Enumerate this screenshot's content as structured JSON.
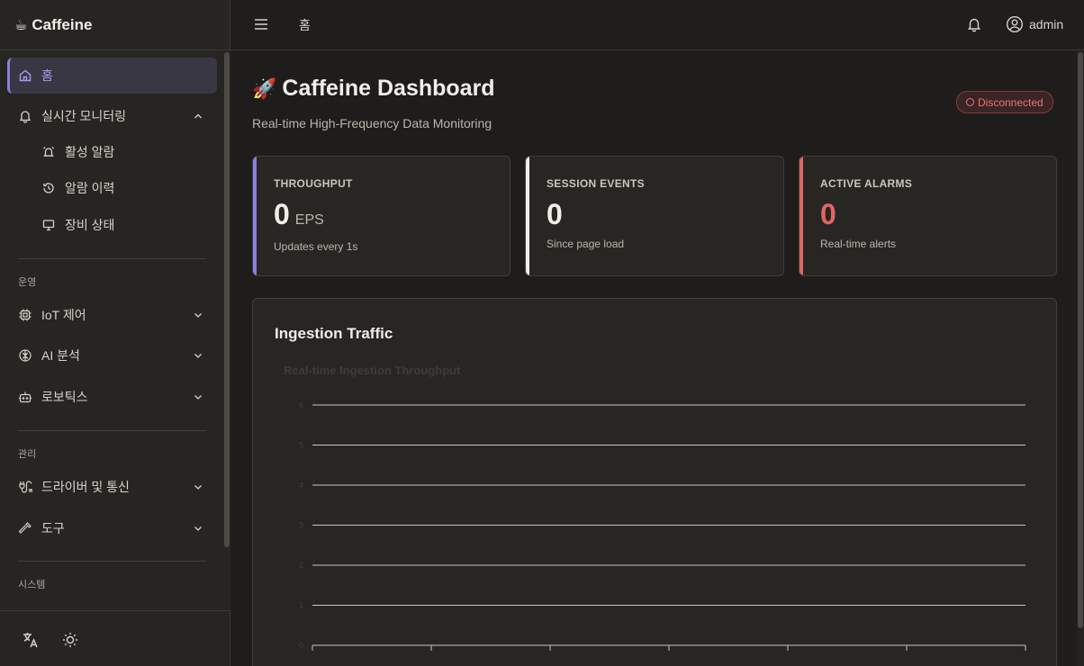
{
  "sidebar": {
    "brand": "Caffeine",
    "brand_icon": "☕",
    "home": "홈",
    "monitoring": "실시간 모니터링",
    "monitoring_sub": [
      "활성 알람",
      "알람 이력",
      "장비 상태"
    ],
    "section_ops": "운영",
    "ops_items": [
      "IoT 제어",
      "AI 분석",
      "로보틱스"
    ],
    "section_admin": "관리",
    "admin_items": [
      "드라이버 및 통신",
      "도구"
    ],
    "section_system": "시스템"
  },
  "topbar": {
    "breadcrumb": "홈",
    "user": "admin"
  },
  "main": {
    "title_icon": "🚀",
    "title": "Caffeine Dashboard",
    "subtitle": "Real-time High-Frequency Data Monitoring",
    "status": "Disconnected",
    "cards": [
      {
        "label": "THROUGHPUT",
        "value": "0",
        "unit": "EPS",
        "note": "Updates every 1s",
        "accent": "#8b7fe0"
      },
      {
        "label": "SESSION EVENTS",
        "value": "0",
        "note": "Since page load",
        "accent": "#f0eee9"
      },
      {
        "label": "ACTIVE ALARMS",
        "value": "0",
        "note": "Real-time alerts",
        "accent": "#e06666"
      }
    ],
    "panel_title": "Ingestion Traffic"
  },
  "chart_data": {
    "type": "line",
    "title": "Real-time Ingestion Throughput",
    "xlabel": "",
    "ylabel": "",
    "ylim": [
      0,
      6
    ],
    "yticks": [
      0,
      1,
      2,
      3,
      4,
      5,
      6
    ],
    "x": [],
    "series": [],
    "grid": true
  }
}
